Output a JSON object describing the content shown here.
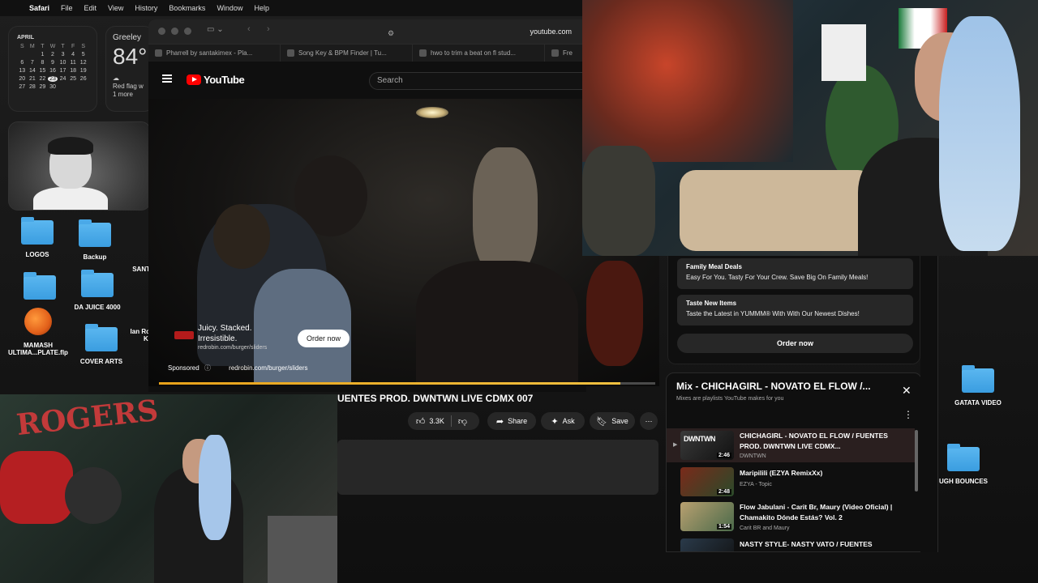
{
  "menubar": {
    "app": "Safari",
    "items": [
      "File",
      "Edit",
      "View",
      "History",
      "Bookmarks",
      "Window",
      "Help"
    ]
  },
  "calendar": {
    "month": "APRIL",
    "headers": [
      "S",
      "M",
      "T",
      "W",
      "T",
      "F",
      "S"
    ],
    "days": [
      "",
      "",
      "1",
      "2",
      "3",
      "4",
      "5",
      "6",
      "7",
      "8",
      "9",
      "10",
      "11",
      "12",
      "13",
      "14",
      "15",
      "16",
      "17",
      "18",
      "19",
      "20",
      "21",
      "22",
      "23",
      "24",
      "25",
      "26",
      "27",
      "28",
      "29",
      "30",
      "",
      "",
      ""
    ],
    "today": "23"
  },
  "weather": {
    "city": "Greeley",
    "temp": "84°",
    "condition": "Red flag w",
    "more": "1 more"
  },
  "desktop_icons": {
    "logos": "LOGOS",
    "backup": "Backup",
    "sant": "SANT",
    "dajuice": "DA JUICE 4000",
    "mamash_1": "MAMASH",
    "mamash_2": "ULTIMA...PLATE.flp",
    "coverarts": "COVER ARTS",
    "ianro_1": "Ian Ro",
    "ianro_2": "Ki",
    "gatata": "GATATA VIDEO",
    "ughbounces": "UGH BOUNCES"
  },
  "safari": {
    "url": "youtube.com",
    "tabs": [
      "Pharrell by santakimex - Pla...",
      "Song Key & BPM Finder | Tu...",
      "hwo to trim a beat on fl stud...",
      "Fre"
    ]
  },
  "youtube": {
    "logo_text": "YouTube",
    "search_placeholder": "Search",
    "ad": {
      "line1": "Juicy. Stacked.",
      "line2": "Irresistible.",
      "domain": "redrobin.com/burger/sliders",
      "button": "Order now",
      "sponsored": "Sponsored",
      "sponsored_domain": "redrobin.com/burger/sliders",
      "progress": 0.93
    },
    "video_title": "UENTES PROD. DWNTWN LIVE CDMX 007",
    "actions": {
      "likes": "3.3K",
      "share": "Share",
      "ask": "Ask",
      "save": "Save"
    }
  },
  "sidebar": {
    "cards": [
      {
        "title": "Family Meal Deals",
        "desc": "Easy For You. Tasty For Your Crew. Save Big On Family Meals!"
      },
      {
        "title": "Taste New Items",
        "desc": "Taste the Latest in YUMMM® With With Our Newest Dishes!"
      }
    ],
    "order_button": "Order now"
  },
  "mix": {
    "title": "Mix - CHICHAGIRL - NOVATO EL FLOW /...",
    "subtitle": "Mixes are playlists YouTube makes for you",
    "items": [
      {
        "title": "CHICHAGIRL - NOVATO EL FLOW / FUENTES PROD. DWNTWN LIVE CDMX...",
        "channel": "DWNTWN",
        "duration": "2:46",
        "thumb": "DWNTWN"
      },
      {
        "title": "Maripilili (EZYA RemixXx)",
        "channel": "EZYA - Topic",
        "duration": "2:48"
      },
      {
        "title": "Flow Jabulani - Carit Br, Maury (Video Oficial) | Chamakito Dónde Estás? Vol. 2",
        "channel": "Carit BR and Maury",
        "duration": "1:54"
      },
      {
        "title": "NASTY STYLE- NASTY VATO / FUENTES",
        "channel": "",
        "duration": ""
      }
    ]
  },
  "webcam": {
    "graffiti": "ROGERS"
  },
  "colors": {
    "youtube_red": "#ff0000",
    "progress": "#e8a21a",
    "folder_blue": "#3a9de0"
  }
}
